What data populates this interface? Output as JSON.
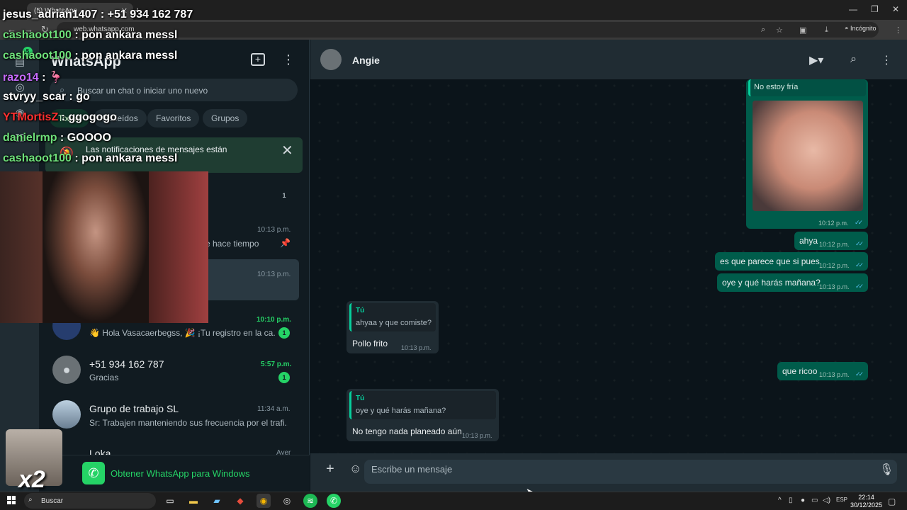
{
  "browser": {
    "tab_title": "(5) WhatsApp",
    "url": "web.whatsapp.com",
    "incognito_label": "Incógnito"
  },
  "sidebar": {
    "app_title": "WhatsApp",
    "rail_badge": "5",
    "search_placeholder": "Buscar un chat o iniciar uno nuevo",
    "filters": [
      "Todos",
      "No leídos",
      "Favoritos",
      "Grupos"
    ],
    "notification_text": "Las notificaciones de mensajes están",
    "chats": [
      {
        "preview_fragment": "e hace tiempo",
        "time": "10:13 p.m.",
        "badge": "1",
        "pinned": true
      },
      {
        "time": "10:13 p.m.",
        "selected": true
      },
      {
        "preview": "👋 Hola Vasacaerbegss, 🎉 ¡Tu registro en la ca...",
        "time": "10:10 p.m.",
        "badge": "1"
      },
      {
        "name": "+51 934 162 787",
        "preview": "Gracias",
        "time": "5:57 p.m.",
        "badge": "1"
      },
      {
        "name": "Grupo de trabajo SL",
        "preview": "Sr: Trabajen manteniendo sus frecuencia por el trafi...",
        "time": "11:34 a.m."
      },
      {
        "name": "Loka",
        "time": "Ayer"
      }
    ],
    "get_app_label": "Obtener WhatsApp para Windows"
  },
  "chat": {
    "contact_name": "Angie",
    "composer_placeholder": "Escribe un mensaje",
    "messages": [
      {
        "dir": "out",
        "quote_text": "No estoy fría",
        "image": true,
        "time": "10:12 p.m."
      },
      {
        "dir": "out",
        "text": "ahya",
        "time": "10:12 p.m."
      },
      {
        "dir": "out",
        "text": "es que parece que si pues",
        "time": "10:12 p.m."
      },
      {
        "dir": "out",
        "text": "oye y qué harás mañana?",
        "time": "10:13 p.m."
      },
      {
        "dir": "in",
        "quote_who": "Tú",
        "quote_text": "ahyaa y que comiste?",
        "text": "Pollo frito",
        "time": "10:13 p.m."
      },
      {
        "dir": "out",
        "text": "que ricoo",
        "time": "10:13 p.m."
      },
      {
        "dir": "in",
        "quote_who": "Tú",
        "quote_text": "oye y qué harás mañana?",
        "text": "No tengo nada planeado aún",
        "time": "10:13 p.m."
      }
    ]
  },
  "overlay": {
    "chat_lines": [
      {
        "name": "jesus_adrian1407",
        "msg": ": +51 934 162 787",
        "color": "#ffffff"
      },
      {
        "name": "cashaoot100",
        "msg": ": pon ankara messl",
        "color": "#6ee07a"
      },
      {
        "name": "cashaoot100",
        "msg": ": pon ankara messl",
        "color": "#6ee07a"
      },
      {
        "name": "razo14",
        "msg": ": 🦩",
        "color": "#c86bff"
      },
      {
        "name": "stvryy_scar",
        "msg": ": go",
        "color": "#ffffff"
      },
      {
        "name": "YTMortisZ",
        "msg": ": ggogogo",
        "color": "#ff3030"
      },
      {
        "name": "danielrmp",
        "msg": ": GOOOO",
        "color": "#6ee07a"
      },
      {
        "name": "cashaoot100",
        "msg": ": pon ankara messl",
        "color": "#6ee07a"
      }
    ],
    "multiplier": "x2"
  },
  "taskbar": {
    "search_label": "Buscar",
    "lang": "ESP",
    "time": "22:14",
    "date": "30/12/2025"
  }
}
